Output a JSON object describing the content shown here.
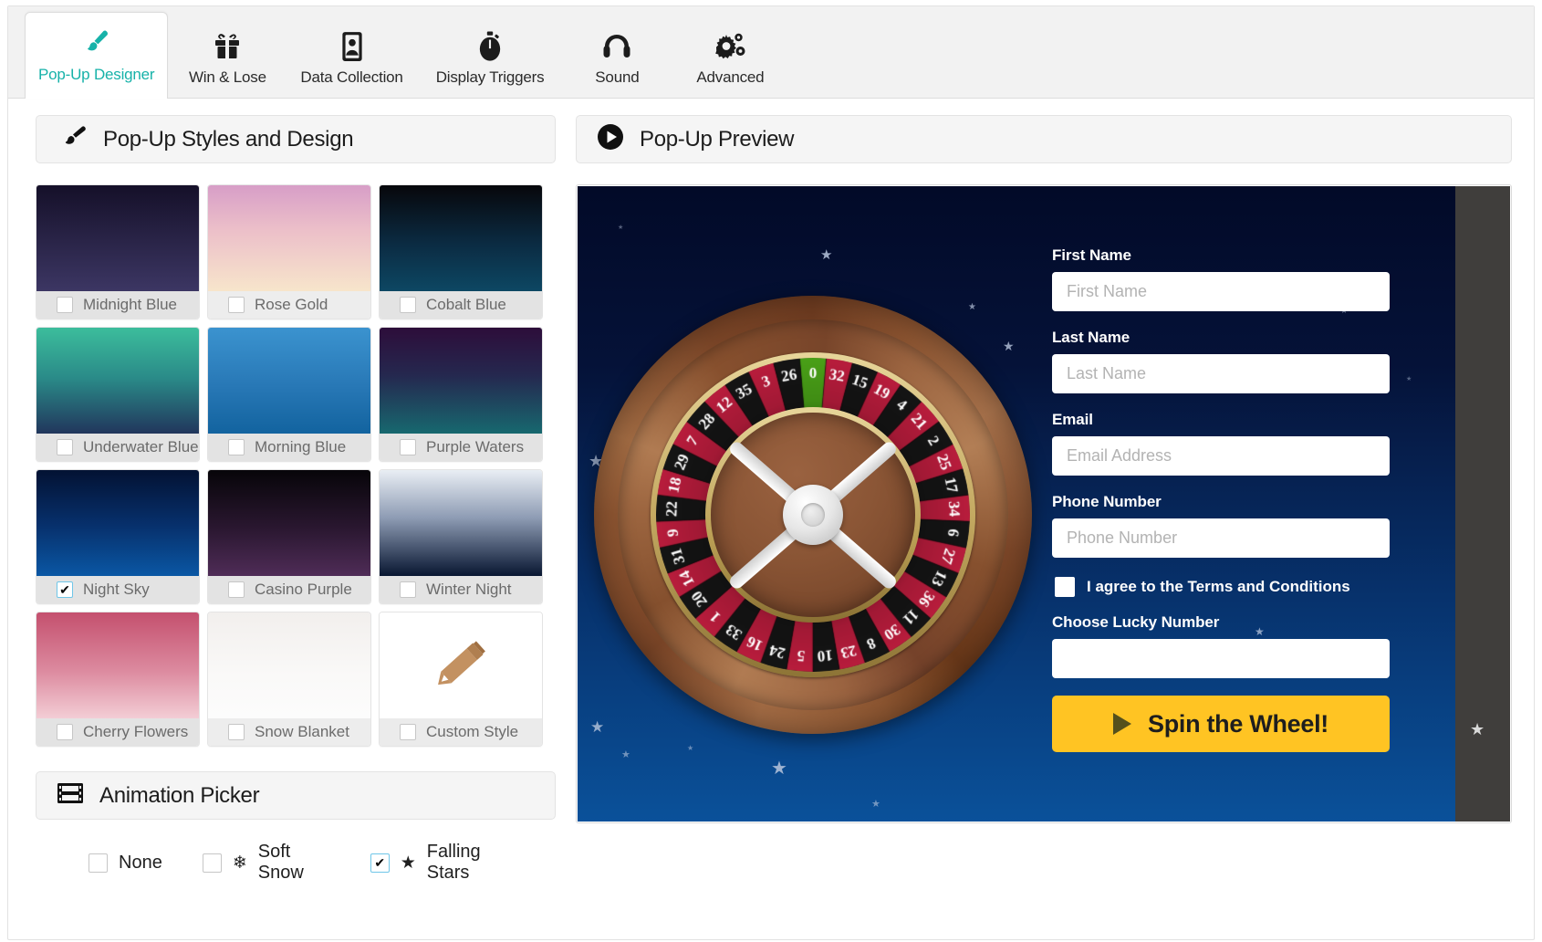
{
  "tabs": [
    {
      "label": "Pop-Up Designer",
      "icon": "paintbrush-icon",
      "active": true
    },
    {
      "label": "Win & Lose",
      "icon": "gift-icon",
      "active": false
    },
    {
      "label": "Data Collection",
      "icon": "contact-card-icon",
      "active": false
    },
    {
      "label": "Display Triggers",
      "icon": "stopwatch-icon",
      "active": false
    },
    {
      "label": "Sound",
      "icon": "headphones-icon",
      "active": false
    },
    {
      "label": "Advanced",
      "icon": "gears-icon",
      "active": false
    }
  ],
  "styles_panel": {
    "title": "Pop-Up Styles and Design",
    "icon": "paintbrush-icon",
    "swatches": [
      {
        "label": "Midnight Blue",
        "checked": false,
        "from": "#151029",
        "to": "#3c3663"
      },
      {
        "label": "Rose Gold",
        "checked": false,
        "from": "#d79ec7",
        "to": "#f7e5cb"
      },
      {
        "label": "Cobalt Blue",
        "checked": false,
        "from": "#07070b",
        "to": "#0d4763"
      },
      {
        "label": "Underwater Blue",
        "checked": false,
        "from": "#3cbd9c",
        "to": "#21365c"
      },
      {
        "label": "Morning Blue",
        "checked": false,
        "from": "#3b93cf",
        "to": "#12639f"
      },
      {
        "label": "Purple Waters",
        "checked": false,
        "from": "#2d0d3a",
        "to": "#17686f"
      },
      {
        "label": "Night Sky",
        "checked": true,
        "from": "#031233",
        "to": "#0a57a4"
      },
      {
        "label": "Casino Purple",
        "checked": false,
        "from": "#070509",
        "to": "#4f2c57"
      },
      {
        "label": "Winter Night",
        "checked": false,
        "from": "#e9eef4",
        "to": "#081631"
      },
      {
        "label": "Cherry Flowers",
        "checked": false,
        "from": "#c4506e",
        "to": "#f3cdd5"
      },
      {
        "label": "Snow Blanket",
        "checked": false,
        "from": "#f2f0ee",
        "to": "#fbfbfb"
      },
      {
        "label": "Custom Style",
        "checked": false,
        "icon": "pencil-icon"
      }
    ]
  },
  "animation_panel": {
    "title": "Animation Picker",
    "icon": "film-strip-icon",
    "options": [
      {
        "label": "None",
        "glyph": "",
        "checked": false
      },
      {
        "label": "Soft Snow",
        "glyph": "❄",
        "checked": false
      },
      {
        "label": "Falling Stars",
        "glyph": "★",
        "checked": true
      }
    ]
  },
  "preview_panel": {
    "title": "Pop-Up Preview",
    "icon": "play-circle-icon",
    "background_style": "Night Sky",
    "form": {
      "fields": [
        {
          "label": "First Name",
          "placeholder": "First Name",
          "value": ""
        },
        {
          "label": "Last Name",
          "placeholder": "Last Name",
          "value": ""
        },
        {
          "label": "Email",
          "placeholder": "Email Address",
          "value": ""
        },
        {
          "label": "Phone Number",
          "placeholder": "Phone Number",
          "value": ""
        }
      ],
      "terms_label": "I agree to the Terms and Conditions",
      "terms_checked": false,
      "lucky_number_label": "Choose Lucky Number",
      "lucky_number_placeholder": "",
      "lucky_number_value": "",
      "spin_button_label": "Spin the Wheel!"
    },
    "wheel": {
      "numbers": [
        0,
        32,
        15,
        19,
        4,
        21,
        2,
        25,
        17,
        34,
        6,
        27,
        13,
        36,
        11,
        30,
        8,
        23,
        10,
        5,
        24,
        16,
        33,
        1,
        20,
        14,
        31,
        9,
        22,
        18,
        29,
        7,
        28,
        12,
        35,
        3,
        26
      ],
      "red_numbers": [
        32,
        19,
        21,
        25,
        34,
        27,
        36,
        30,
        23,
        5,
        16,
        1,
        14,
        9,
        18,
        7,
        12,
        3
      ],
      "zero_color": "#49a017",
      "red_color": "#b81c3c",
      "black_color": "#141414"
    }
  },
  "colors": {
    "accent": "#17b2a9",
    "spin_button": "#ffc423",
    "panel_header_bg": "#f5f5f5"
  }
}
